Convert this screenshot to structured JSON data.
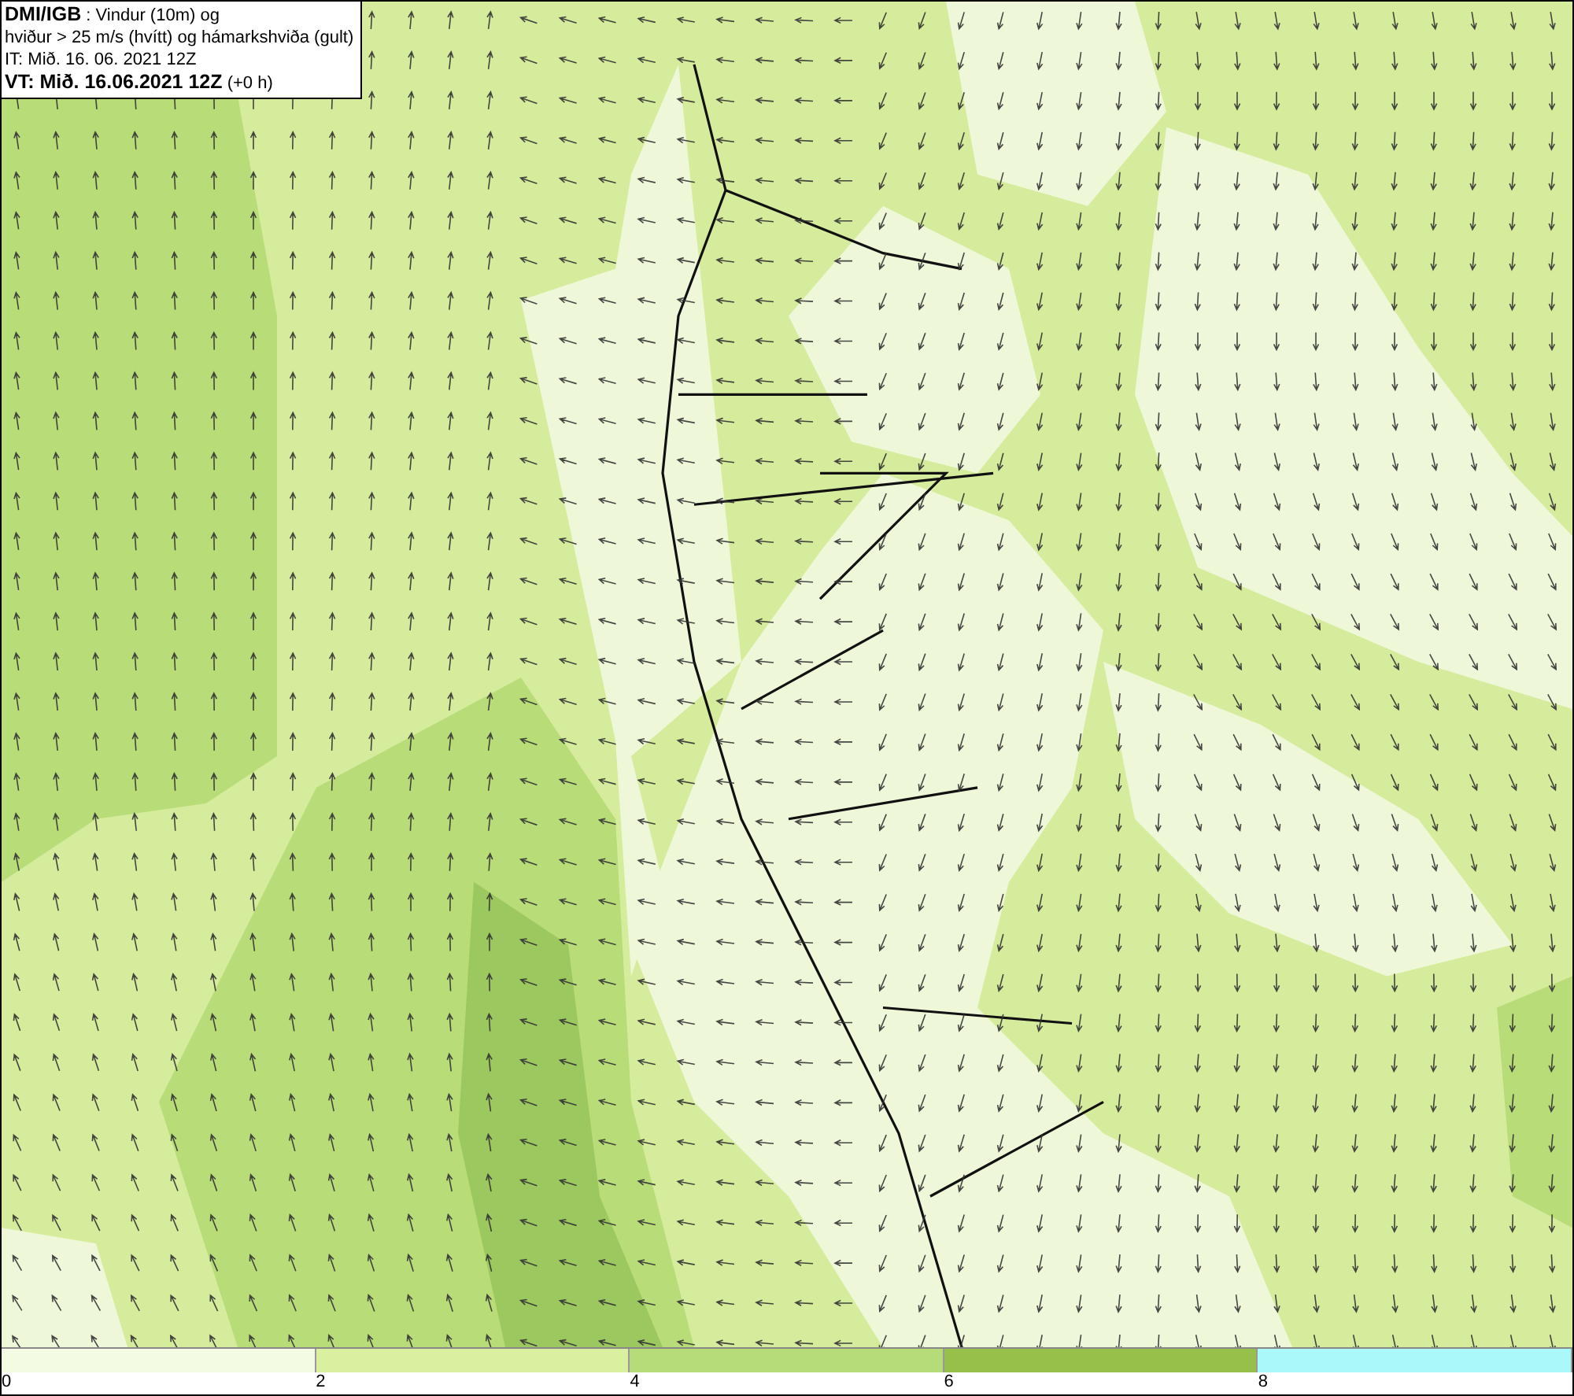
{
  "title_box": {
    "lines": [
      "**DMI/IGB** : Vindur (10m) og",
      "hviður > 25 m/s (hvítt) og hámarkshviða (gult)",
      "IT: Mið. 16. 06. 2021 12Z",
      "**VT: Mið. 16.06.2021 12Z** (+0 h)"
    ]
  },
  "legend": {
    "bins": [
      {
        "color": "#f3fbe2",
        "label": "0"
      },
      {
        "color": "#d8f0a0",
        "label": "2"
      },
      {
        "color": "#b5dc78",
        "label": "4"
      },
      {
        "color": "#96c04a",
        "label": "6"
      },
      {
        "color": "#aaf8f8",
        "label": "8"
      }
    ]
  }
}
